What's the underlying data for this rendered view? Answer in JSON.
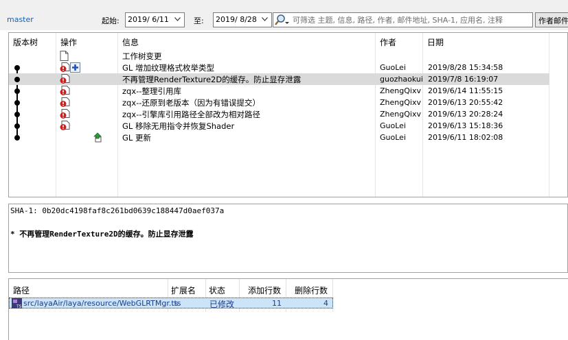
{
  "toolbar": {
    "branch": "master",
    "from_label": "起始:",
    "from_date": "2019/ 6/11",
    "to_label": "至:",
    "to_date": "2019/ 8/28",
    "search_placeholder": "可筛选 主题, 信息, 路径, 作者, 邮件地址, SHA-1, 应用名, 注释",
    "author_button": "作者邮件"
  },
  "grid": {
    "columns": [
      "版本树",
      "操作",
      "信息",
      "作者",
      "日期"
    ],
    "rows": [
      {
        "message": "工作树变更",
        "author": "",
        "date": "",
        "icons": [
          "file-icon"
        ],
        "selected": false
      },
      {
        "message": "GL 增加纹理格式枚举类型",
        "author": "GuoLei",
        "date": "2019/8/28 15:34:58",
        "icons": [
          "modified-file-icon",
          "blue-plus-icon"
        ],
        "selected": false
      },
      {
        "message": "不再管理RenderTexture2D的缓存。防止显存泄露",
        "author": "guozhaokui",
        "date": "2019/7/8 16:19:07",
        "icons": [
          "modified-file-icon"
        ],
        "selected": true
      },
      {
        "message": "zqx--整理引用库",
        "author": "ZhengQixv",
        "date": "2019/6/14 11:55:15",
        "icons": [
          "modified-file-icon"
        ],
        "selected": false
      },
      {
        "message": "zqx--还原到老版本（因为有错误提交）",
        "author": "ZhengQixv",
        "date": "2019/6/13 20:55:42",
        "icons": [
          "modified-file-icon"
        ],
        "selected": false
      },
      {
        "message": "zqx--引擎库引用路径全部改为相对路径",
        "author": "ZhengQixv",
        "date": "2019/6/13 20:28:24",
        "icons": [
          "modified-file-icon"
        ],
        "selected": false
      },
      {
        "message": "GL 移除无用指令并恢复Shader",
        "author": "GuoLei",
        "date": "2019/6/13 15:18:36",
        "icons": [
          "modified-file-icon"
        ],
        "selected": false
      },
      {
        "message": "GL 更新",
        "author": "GuoLei",
        "date": "2019/6/11 18:02:08",
        "icons": [
          "green-arrow-icon"
        ],
        "selected": false
      }
    ]
  },
  "detail": {
    "sha": "SHA-1: 0b20dc4198faf8c261bd0639c188447d0aef037a",
    "message": "* 不再管理RenderTexture2D的缓存。防止显存泄露"
  },
  "files": {
    "columns": [
      "路径",
      "扩展名",
      "状态",
      "添加行数",
      "删除行数"
    ],
    "rows": [
      {
        "path": "src/layaAir/laya/resource/WebGLRTMgr.ts",
        "ext": ".ts",
        "status": "已修改",
        "added": "11",
        "removed": "4"
      }
    ]
  },
  "colors": {
    "selected_row": "#dadada",
    "file_selected": "#cce4f7",
    "link": "#1a5fb4",
    "modified_icon": "#cc1f1f"
  }
}
